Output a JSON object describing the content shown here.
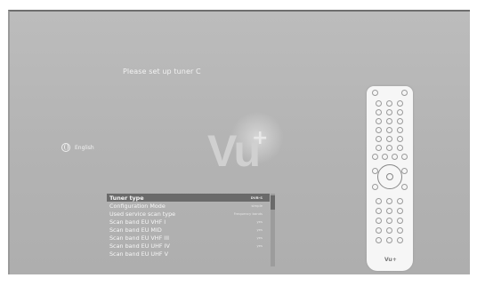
{
  "prompt": "Please set up tuner C",
  "language": {
    "label": "English"
  },
  "logo": {
    "text": "Vu",
    "plus": "+"
  },
  "menu": [
    {
      "label": "Tuner type",
      "value": "DVB-S",
      "selected": true
    },
    {
      "label": "Configuration Mode",
      "value": "simple",
      "selected": false
    },
    {
      "label": "Used service scan type",
      "value": "Frequency bands",
      "selected": false
    },
    {
      "label": "Scan band EU VHF I",
      "value": "yes",
      "selected": false
    },
    {
      "label": "Scan band EU MID",
      "value": "yes",
      "selected": false
    },
    {
      "label": "Scan band EU VHF III",
      "value": "yes",
      "selected": false
    },
    {
      "label": "Scan band EU UHF IV",
      "value": "yes",
      "selected": false
    },
    {
      "label": "Scan band EU UHF V",
      "value": "",
      "selected": false
    }
  ],
  "remote": {
    "brand": "Vu+"
  },
  "colors": {
    "screen": "#b5b5b5",
    "selection": "#6a6a6a",
    "text": "#f5f5f5"
  }
}
